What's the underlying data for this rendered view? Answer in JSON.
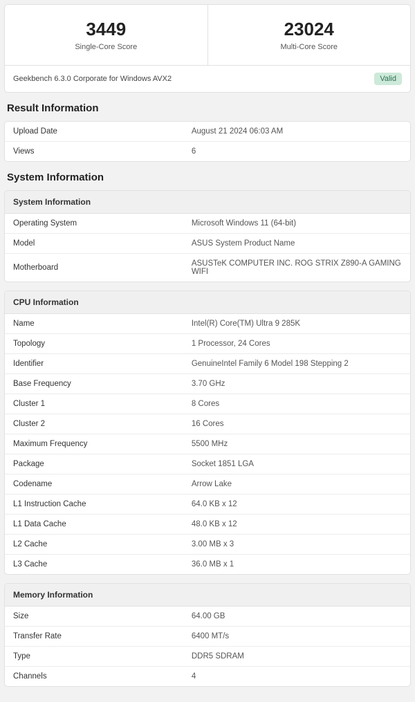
{
  "scores": {
    "single_value": "3449",
    "single_label": "Single-Core Score",
    "multi_value": "23024",
    "multi_label": "Multi-Core Score"
  },
  "version_line": "Geekbench 6.3.0 Corporate for Windows AVX2",
  "valid_badge": "Valid",
  "result_heading": "Result Information",
  "result_rows": [
    {
      "key": "Upload Date",
      "val": "August 21 2024 06:03 AM"
    },
    {
      "key": "Views",
      "val": "6"
    }
  ],
  "system_heading": "System Information",
  "sys_section_title": "System Information",
  "sys_rows": [
    {
      "key": "Operating System",
      "val": "Microsoft Windows 11 (64-bit)"
    },
    {
      "key": "Model",
      "val": "ASUS System Product Name"
    },
    {
      "key": "Motherboard",
      "val": "ASUSTeK COMPUTER INC. ROG STRIX Z890-A GAMING WIFI"
    }
  ],
  "cpu_section_title": "CPU Information",
  "cpu_rows": [
    {
      "key": "Name",
      "val": "Intel(R) Core(TM) Ultra 9 285K"
    },
    {
      "key": "Topology",
      "val": "1 Processor, 24 Cores"
    },
    {
      "key": "Identifier",
      "val": "GenuineIntel Family 6 Model 198 Stepping 2"
    },
    {
      "key": "Base Frequency",
      "val": "3.70 GHz"
    },
    {
      "key": "Cluster 1",
      "val": "8 Cores"
    },
    {
      "key": "Cluster 2",
      "val": "16 Cores"
    },
    {
      "key": "Maximum Frequency",
      "val": "5500 MHz"
    },
    {
      "key": "Package",
      "val": "Socket 1851 LGA"
    },
    {
      "key": "Codename",
      "val": "Arrow Lake"
    },
    {
      "key": "L1 Instruction Cache",
      "val": "64.0 KB x 12"
    },
    {
      "key": "L1 Data Cache",
      "val": "48.0 KB x 12"
    },
    {
      "key": "L2 Cache",
      "val": "3.00 MB x 3"
    },
    {
      "key": "L3 Cache",
      "val": "36.0 MB x 1"
    }
  ],
  "mem_section_title": "Memory Information",
  "mem_rows": [
    {
      "key": "Size",
      "val": "64.00 GB"
    },
    {
      "key": "Transfer Rate",
      "val": "6400 MT/s"
    },
    {
      "key": "Type",
      "val": "DDR5 SDRAM"
    },
    {
      "key": "Channels",
      "val": "4"
    }
  ]
}
